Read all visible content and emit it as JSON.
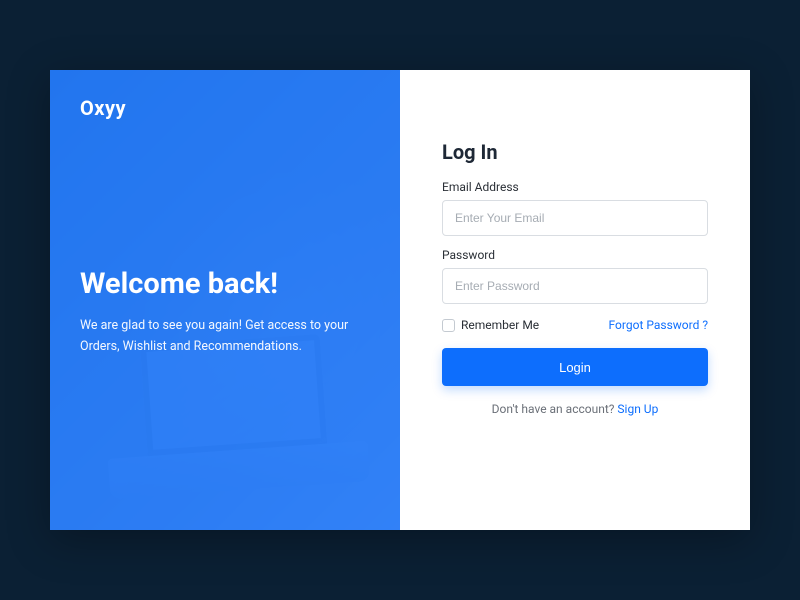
{
  "brand": {
    "name": "Oxyy"
  },
  "hero": {
    "title": "Welcome back!",
    "subtitle": "We are glad to see you again! Get access to your Orders, Wishlist and Recommendations."
  },
  "form": {
    "title": "Log In",
    "email_label": "Email Address",
    "email_placeholder": "Enter Your Email",
    "email_value": "",
    "password_label": "Password",
    "password_placeholder": "Enter Password",
    "password_value": "",
    "remember_label": "Remember Me",
    "forgot_label": "Forgot Password ?",
    "submit_label": "Login",
    "signup_prompt": "Don't have an account? ",
    "signup_link": "Sign Up"
  },
  "colors": {
    "primary": "#0d6efd"
  }
}
